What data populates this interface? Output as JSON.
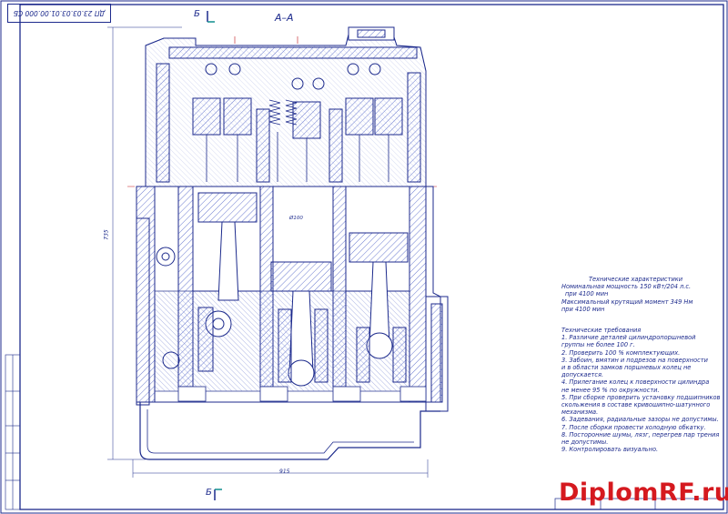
{
  "drawing": {
    "stamp": "ДП 23.03.03.01.00.000 СБ",
    "section_title": "А–А",
    "cut_label_top": "Б",
    "cut_label_bottom": "Б",
    "dim_height": "735",
    "dim_width": "915",
    "dim_bore": "Ø100"
  },
  "specs": {
    "title": "Технические характеристики",
    "lines": [
      "Номинальная мощность 150 кВт/204 л.с.",
      "  при 4100 мин",
      "Максимальный крутящий момент 349 Нм",
      "при 4100 мин"
    ]
  },
  "requirements": {
    "title": "Технические требования",
    "lines": [
      "1. Различие деталей цилиндропоршневой",
      "группы не более 100 г.",
      "2. Проверить 100 % комплектующих.",
      "3. Забоин, вмятин и подрезов на поверхности",
      "и в области замков поршневых колец не",
      "допускается.",
      "4. Прилегание колец к поверхности цилиндра",
      "не менее 95 % по окружности.",
      "5. При сборке проверить установку подшипников",
      " скольжения в составе кривошипно-шатунного",
      "механизма.",
      "6. Задевания, радиальные зазоры не допустимы.",
      "7. После сборки провести холодную обкатку.",
      "8. Посторонние шумы, лязг, перегрев пар трения",
      " не допустимы.",
      "9. Контролировать визуально."
    ]
  },
  "watermark": "DiplomRF.ru",
  "colors": {
    "line": "#1c2a8c",
    "hatch": "#6b7bd0",
    "red": "#c2141b",
    "teal": "#0f8e8e",
    "watermark": "#d5191f"
  }
}
